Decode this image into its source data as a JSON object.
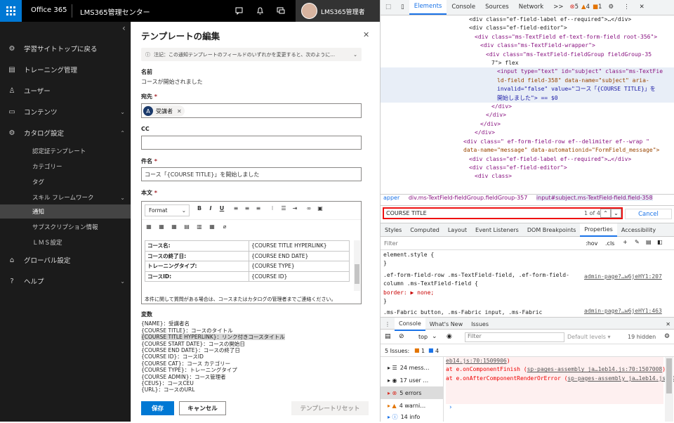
{
  "topbar": {
    "brand": "Office 365",
    "app_title": "LMS365管理センター",
    "user_name": "LMS365管理者",
    "icons": [
      "chat-icon",
      "bell-icon",
      "feedback-icon"
    ]
  },
  "nav": {
    "items": [
      {
        "label": "学習サイトトップに戻る",
        "icon": "gear-icon"
      },
      {
        "label": "トレーニング管理",
        "icon": "book-icon"
      },
      {
        "label": "ユーザー",
        "icon": "user-icon"
      },
      {
        "label": "コンテンツ",
        "icon": "folder-icon"
      },
      {
        "label": "カタログ設定",
        "icon": "gear-icon"
      },
      {
        "label": "グローバル設定",
        "icon": "globe-icon"
      },
      {
        "label": "ヘルプ",
        "icon": "help-icon"
      }
    ],
    "sub_items": [
      "認定証テンプレート",
      "カテゴリー",
      "タグ",
      "スキル フレームワーク",
      "通知",
      "サブスクリプション情報",
      "ＬＭＳ設定"
    ],
    "active_sub": "通知"
  },
  "panel": {
    "title": "テンプレートの編集",
    "notice": "注記：この通知テンプレートのフィールドのいずれかを変更すると、次のように...",
    "name_label": "名前",
    "name_value": "コースが開始されました",
    "to_label": "宛先",
    "recipient": "受講者",
    "recipient_initial": "A",
    "cc_label": "CC",
    "subject_label": "件名",
    "subject_value": "コース「{COURSE TITLE}」を開始しました",
    "body_label": "本文",
    "format_label": "Format",
    "table": [
      [
        "コース名:",
        "{COURSE TITLE HYPERLINK}"
      ],
      [
        "コースの終了日:",
        "{COURSE END DATE}"
      ],
      [
        "トレーニングタイプ:",
        "{COURSE TYPE}"
      ],
      [
        "コースID:",
        "{COURSE ID}"
      ]
    ],
    "body_footer": "本件に関して質問がある場合は、コースまたはカタログの管理者までご連絡ください。",
    "vars_title": "変数",
    "vars": [
      "{NAME}：受講者名",
      "{COURSE TITLE}：コースのタイトル",
      "{COURSE TITLE HYPERLINK}：リンク付きコースタイトル",
      "{COURSE START DATE}：コースの開始日",
      "{COURSE END DATE}：コースの終了日",
      "{COURSE ID}：コースID",
      "{COURSE CAT}：コース カテゴリー",
      "{COURSE TYPE}：トレーニングタイプ",
      "{COURSE ADMIN}：コース管理者",
      "{CEUS}：コースCEU",
      "{URL}：コースのURL"
    ],
    "save": "保存",
    "cancel": "キャンセル",
    "reset": "テンプレートリセット"
  },
  "devtools": {
    "tabs": [
      "Elements",
      "Console",
      "Sources",
      "Network",
      ">>"
    ],
    "active_tab": "Elements",
    "badge_errors": "5",
    "badge_warnings": "4",
    "badge_info": "1",
    "dom_lines": [
      "<div class=\"ef-field-label ef--required\">…</div>",
      "<div class=\"ef-field-editor\">",
      "<div class=\"ms-TextField ef-text-form-field root-356\">",
      "<div class=\"ms-TextField-wrapper\">",
      "<div class=\"ms-TextField-fieldGroup fieldGroup-35",
      "7\">  flex",
      "<input type=\"text\" id=\"subject\" class=\"ms-TextFie",
      "ld-field field-358\" data-name=\"subject\" aria-",
      "invalid=\"false\" value=\"コース「{COURSE TITLE}」を",
      "開始しました\"> == $0",
      "</div>",
      "</div>",
      "</div>",
      "</div>",
      "<div class=\" ef-form-field-row ef--delimiter ef--wrap  \"",
      "data-name=\"message\" data-automationid=\"FormField_message\">",
      "<div class=\"ef-field-label ef--required\">…</div>",
      "<div class=\"ef-field-editor\">",
      "<div class>"
    ],
    "breadcrumb": [
      "apper",
      "div.ms-TextField-fieldGroup.fieldGroup-357",
      "input#subject.ms-TextField-field.field-358"
    ],
    "search_query": "COURSE TITLE",
    "search_count": "1 of 4",
    "cancel": "Cancel",
    "style_tabs": [
      "Styles",
      "Computed",
      "Layout",
      "Event Listeners",
      "DOM Breakpoints",
      "Properties",
      "Accessibility"
    ],
    "active_style_tab": "Properties",
    "filter_placeholder": "Filter",
    "hov": ":hov",
    "cls": ".cls",
    "styles_lines": [
      "element.style {",
      "}",
      ".ef-form-field-row .ms-TextField-field, .ef-form-field-",
      "column .ms-TextField-field {",
      "  border: ▶ none;",
      "}",
      ".ms-Fabric button, .ms-Fabric input, .ms-Fabric"
    ],
    "style_links": [
      "admin-page?…w6jeHY1:207",
      "admin-page?…w6jeHY1:463"
    ],
    "drawer_tabs": [
      "Console",
      "What's New",
      "Issues"
    ],
    "console_context": "top",
    "console_filter": "Filter",
    "default_levels": "Default levels ▾",
    "hidden": "19 hidden",
    "issues_label": "5 Issues:",
    "issues_warn": "1",
    "issues_info": "4",
    "side_items": [
      "24 mess…",
      "17 user …",
      "5 errors",
      "4 warni…",
      "14 info"
    ],
    "error_lines": [
      [
        "    at e.onComponentFinish (",
        "sp-pages-assembly_ja…1eb14.js:70:1507008",
        ")"
      ],
      [
        "    at e.onAfterComponentRenderOrError (",
        "sp-pages-assembly_ja…1eb14.js:70:1506358",
        ")"
      ]
    ],
    "error_top": [
      "eb14.js:70:1509906",
      ")"
    ]
  },
  "colors": {
    "accent": "#0078d4",
    "nav_bg": "#1b1b1b",
    "error": "#e81123"
  }
}
